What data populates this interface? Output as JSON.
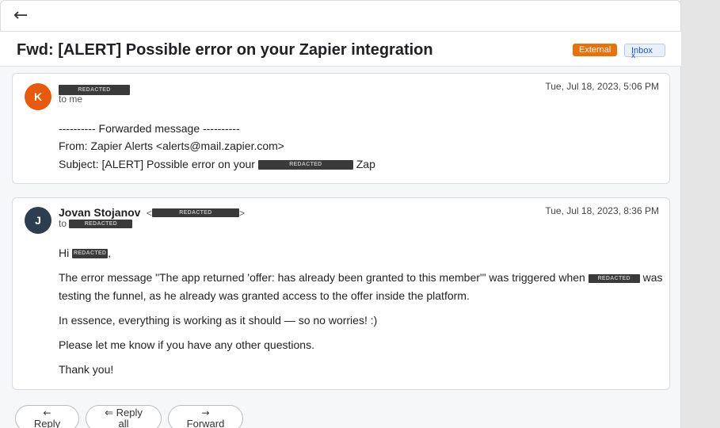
{
  "toolbar": {
    "back_icon": "left-arrow-icon"
  },
  "thread": {
    "subject": "Fwd: [ALERT] Possible error on your Zapier integration",
    "badges": {
      "external": "External",
      "inbox": "Inbox",
      "inbox_remove": "x"
    }
  },
  "redacted_label": "REDACTED",
  "messages": [
    {
      "avatar_letter": "K",
      "avatar_color": "#e8590c",
      "to_line": "to me",
      "date": "Tue, Jul 18, 2023, 5:06 PM",
      "forward_header": "---------- Forwarded message ----------",
      "from_line": "From: Zapier Alerts <alerts@mail.zapier.com>",
      "subject_prefix": "Subject: [ALERT] Possible error on your",
      "subject_suffix": "Zap"
    },
    {
      "avatar_letter": "J",
      "avatar_color": "#2d3e50",
      "sender_name": "Jovan Stojanov",
      "email_open": "<",
      "email_close": ">",
      "to_prefix": "to",
      "date": "Tue, Jul 18, 2023, 8:36 PM",
      "greeting": "Hi",
      "greeting_punct": ",",
      "para1_start": "The error message \"The app returned 'offer: has already been granted to this member'\" was triggered when",
      "para1_mid": "was",
      "para1_line2": "testing the funnel, as he already was granted access to the offer inside the platform.",
      "para2": "In essence, everything is working as it should — so no worries! :)",
      "para3": "Please let me know if you have any other questions.",
      "para4": "Thank you!"
    }
  ],
  "actions": {
    "reply": {
      "icon": "←",
      "label": "Reply"
    },
    "reply_all": {
      "icon": "⇐ Reply",
      "label": "all"
    },
    "forward": {
      "icon": "→",
      "label": "Forward"
    }
  }
}
